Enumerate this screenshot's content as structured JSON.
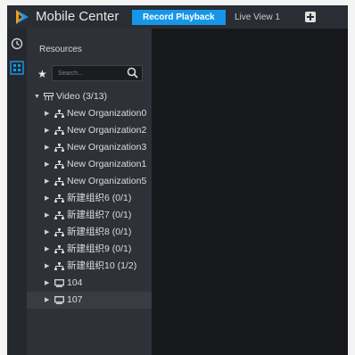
{
  "header": {
    "app_title": "Mobile Center",
    "tabs": [
      {
        "label": "Record Playback",
        "active": true
      },
      {
        "label": "Live View 1",
        "active": false
      }
    ],
    "add_tab_icon": "plus-square-icon",
    "logo_icon": "app-logo-icon"
  },
  "rail": {
    "items": [
      {
        "icon": "history-icon"
      },
      {
        "icon": "resource-tree-icon",
        "active": true
      }
    ]
  },
  "resources": {
    "title": "Resources",
    "favorites_icon": "star-icon",
    "search": {
      "placeholder": "Search...",
      "value": ""
    },
    "tree": {
      "root": {
        "label": "Video (3/13)",
        "expanded": true,
        "icon": "camera-group-icon"
      },
      "children": [
        {
          "label": "New Organization0",
          "icon": "organization-icon"
        },
        {
          "label": "New Organization2",
          "icon": "organization-icon"
        },
        {
          "label": "New Organization3",
          "icon": "organization-icon"
        },
        {
          "label": "New Organization1",
          "icon": "organization-icon"
        },
        {
          "label": "New Organization5",
          "icon": "organization-icon"
        },
        {
          "label": "新建组织6 (0/1)",
          "icon": "organization-icon"
        },
        {
          "label": "新建组织7 (0/1)",
          "icon": "organization-icon"
        },
        {
          "label": "新建组织8 (0/1)",
          "icon": "organization-icon"
        },
        {
          "label": "新建组织9 (0/1)",
          "icon": "organization-icon"
        },
        {
          "label": "新建组织10 (1/2)",
          "icon": "organization-icon"
        },
        {
          "label": "104",
          "icon": "device-icon"
        },
        {
          "label": "107",
          "icon": "device-icon",
          "highlighted": true
        }
      ]
    }
  },
  "colors": {
    "accent": "#1596e8",
    "background": "#1b1d22",
    "panel": "#2e3137",
    "topbar": "#2a2d33"
  }
}
